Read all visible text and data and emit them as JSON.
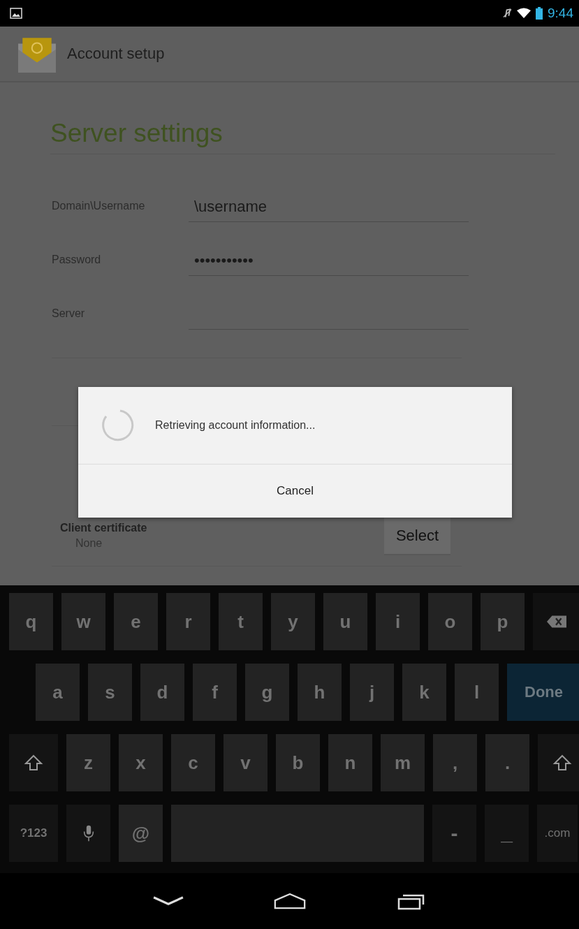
{
  "status_bar": {
    "time": "9:44"
  },
  "action_bar": {
    "title": "Account setup"
  },
  "form": {
    "heading": "Server settings",
    "fields": [
      {
        "label": "Domain\\Username",
        "value": "\\username"
      },
      {
        "label": "Password",
        "value": "•••••••••••"
      },
      {
        "label": "Server"
      }
    ],
    "client_certificate": {
      "label": "Client certificate",
      "value": "None",
      "button": "Select"
    }
  },
  "dialog": {
    "message": "Retrieving account information...",
    "button": "Cancel"
  },
  "keyboard": {
    "rows": [
      {
        "keys": [
          {
            "kind": "letter",
            "label": "q"
          },
          {
            "kind": "letter",
            "label": "w"
          },
          {
            "kind": "letter",
            "label": "e"
          },
          {
            "kind": "letter",
            "label": "r"
          },
          {
            "kind": "letter",
            "label": "t"
          },
          {
            "kind": "letter",
            "label": "y"
          },
          {
            "kind": "letter",
            "label": "u"
          },
          {
            "kind": "letter",
            "label": "i"
          },
          {
            "kind": "letter",
            "label": "o"
          },
          {
            "kind": "letter",
            "label": "p"
          },
          {
            "kind": "backspace"
          }
        ]
      },
      {
        "keys": [
          {
            "kind": "letter",
            "label": "a"
          },
          {
            "kind": "letter",
            "label": "s"
          },
          {
            "kind": "letter",
            "label": "d"
          },
          {
            "kind": "letter",
            "label": "f"
          },
          {
            "kind": "letter",
            "label": "g"
          },
          {
            "kind": "letter",
            "label": "h"
          },
          {
            "kind": "letter",
            "label": "j"
          },
          {
            "kind": "letter",
            "label": "k"
          },
          {
            "kind": "letter",
            "label": "l"
          },
          {
            "kind": "done",
            "label": "Done"
          }
        ]
      },
      {
        "keys": [
          {
            "kind": "shift"
          },
          {
            "kind": "letter",
            "label": "z"
          },
          {
            "kind": "letter",
            "label": "x"
          },
          {
            "kind": "letter",
            "label": "c"
          },
          {
            "kind": "letter",
            "label": "v"
          },
          {
            "kind": "letter",
            "label": "b"
          },
          {
            "kind": "letter",
            "label": "n"
          },
          {
            "kind": "letter",
            "label": "m"
          },
          {
            "kind": "letter",
            "label": ","
          },
          {
            "kind": "letter",
            "label": "."
          },
          {
            "kind": "shift"
          }
        ]
      },
      {
        "keys": [
          {
            "kind": "mode",
            "label": "?123"
          },
          {
            "kind": "mic"
          },
          {
            "kind": "letter",
            "label": "@"
          },
          {
            "kind": "space"
          },
          {
            "kind": "symbol",
            "label": "-"
          },
          {
            "kind": "symbol",
            "label": "_"
          },
          {
            "kind": "domain",
            "label": ".com"
          }
        ]
      }
    ]
  }
}
